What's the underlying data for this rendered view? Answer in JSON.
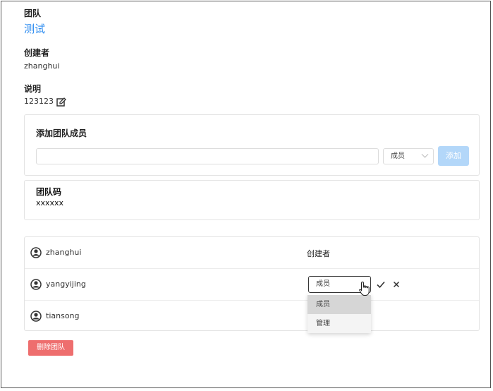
{
  "team": {
    "label": "团队",
    "name": "测试"
  },
  "creator": {
    "label": "创建者",
    "value": "zhanghui"
  },
  "description": {
    "label": "说明",
    "value": "123123",
    "edit_icon": "edit-icon"
  },
  "add_member": {
    "title": "添加团队成员",
    "input_value": "",
    "role_selected": "成员",
    "add_label": "添加",
    "add_button_color": "#b3d7f9"
  },
  "team_code": {
    "title": "团队码",
    "value": "xxxxxx"
  },
  "members": [
    {
      "name": "zhanghui",
      "role": "创建者"
    },
    {
      "name": "yangyijing",
      "role_editing": "成员"
    },
    {
      "name": "tiansong"
    }
  ],
  "role_dropdown": {
    "options": [
      "成员",
      "管理"
    ],
    "highlighted": "成员"
  },
  "delete_team_label": "删除团队",
  "colors": {
    "accent": "#2d8cf0",
    "danger": "#ee6e6e"
  }
}
